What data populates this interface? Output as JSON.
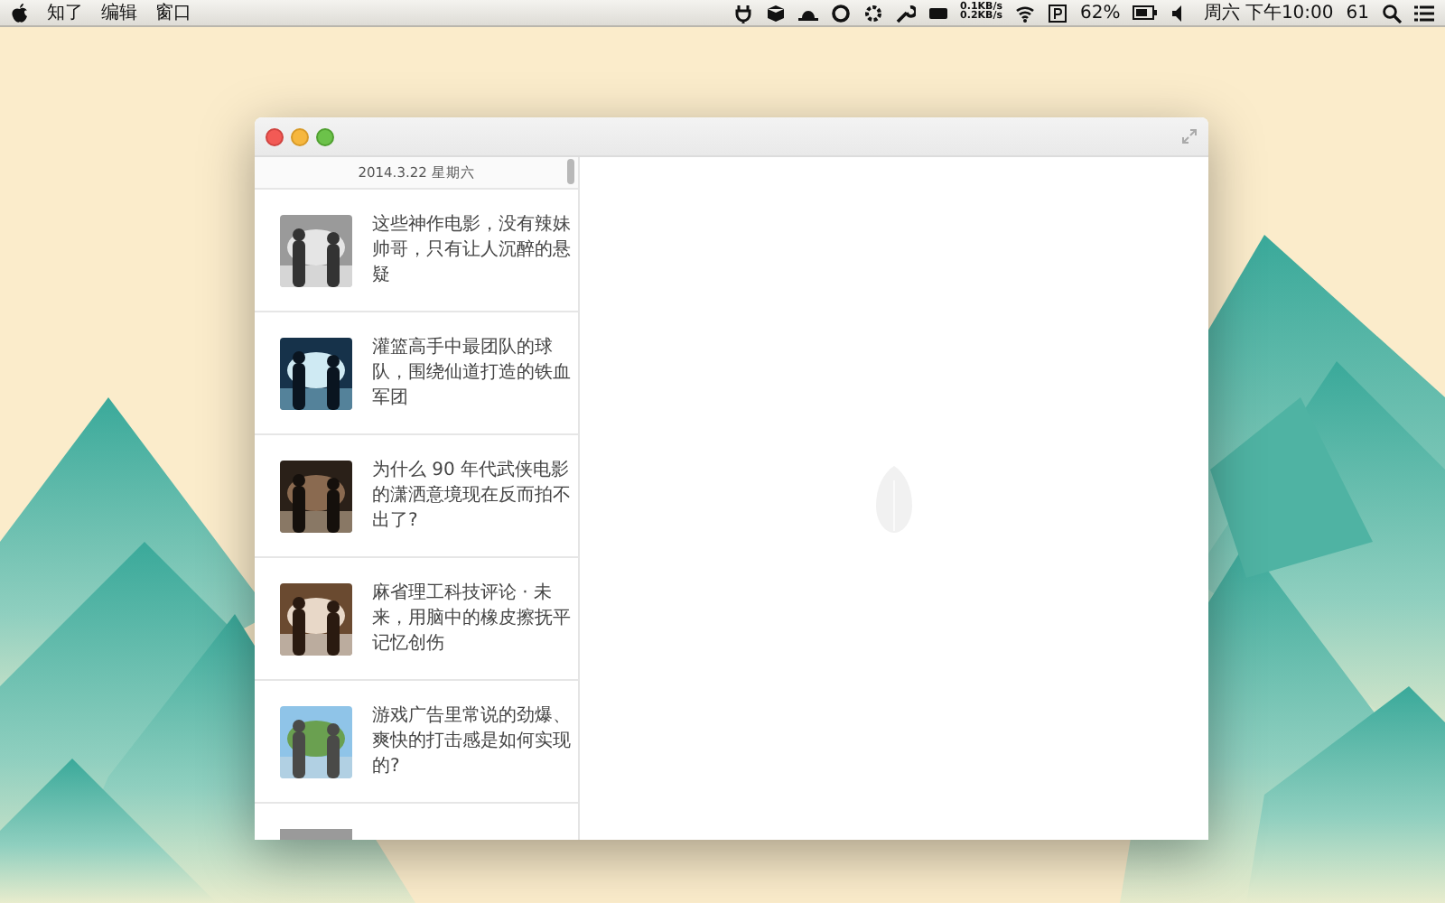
{
  "menu_bar": {
    "menus": [
      "知了",
      "编辑",
      "窗口"
    ],
    "network": {
      "upload": "0.1KB/s",
      "download": "0.2KB/s"
    },
    "battery": "62%",
    "clock": "周六 下午10:00",
    "counter": "61"
  },
  "window": {
    "date_header": "2014.3.22 星期六",
    "items": [
      {
        "title": "这些神作电影，没有辣妹帅哥，只有让人沉醉的悬疑"
      },
      {
        "title": "灌篮高手中最团队的球队，围绕仙道打造的铁血军团"
      },
      {
        "title": "为什么 90 年代武侠电影的潇洒意境现在反而拍不出了?"
      },
      {
        "title": "麻省理工科技评论 · 未来，用脑中的橡皮擦抚平记忆创伤"
      },
      {
        "title": "游戏广告里常说的劲爆、爽快的打击感是如何实现的?"
      }
    ]
  }
}
